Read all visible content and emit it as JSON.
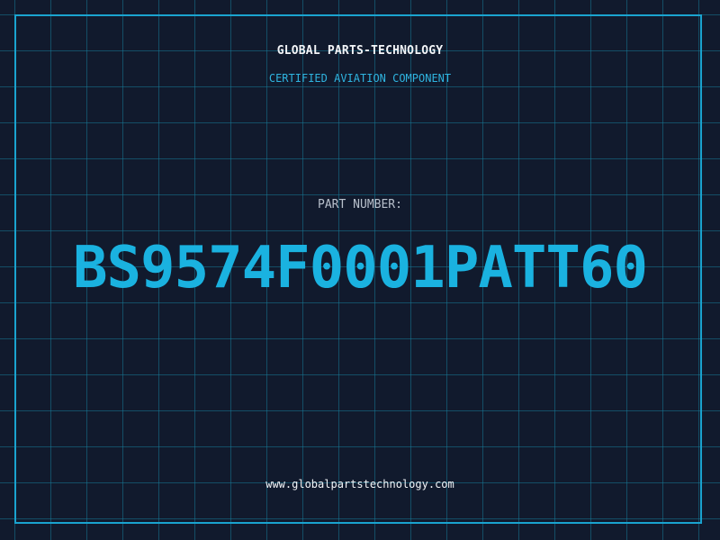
{
  "header": {
    "company": "GLOBAL PARTS-TECHNOLOGY",
    "subtitle": "CERTIFIED AVIATION COMPONENT"
  },
  "main": {
    "label": "PART NUMBER:",
    "part_number": "BS9574F0001PATT60"
  },
  "footer": {
    "url": "www.globalpartstechnology.com"
  },
  "colors": {
    "background": "#111a2d",
    "grid": "#16789a",
    "frame": "#1aa3cf",
    "accent": "#1ab2e0",
    "title_text": "#f3f5f8",
    "label_text": "#b8c0cc"
  }
}
